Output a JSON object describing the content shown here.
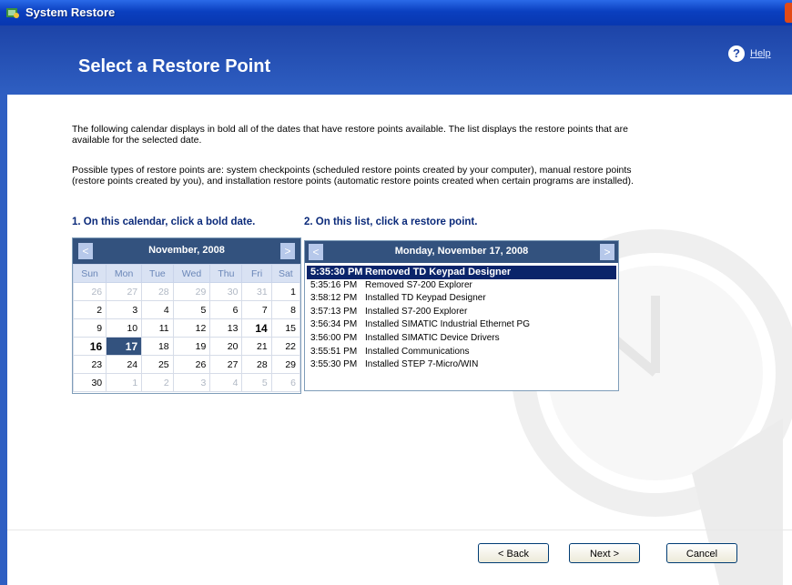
{
  "window": {
    "title": "System Restore"
  },
  "header": {
    "heading": "Select a Restore Point",
    "help_label": "Help"
  },
  "intro": {
    "p1": "The following calendar displays in bold all of the dates that have restore points available. The list displays the restore points that are available for the selected date.",
    "p2": "Possible types of restore points are: system checkpoints (scheduled restore points created by your computer), manual restore points (restore points created by you), and installation restore points (automatic restore points created when certain programs are installed)."
  },
  "steps": {
    "calendar_label": "1. On this calendar, click a bold date.",
    "list_label": "2. On this list, click a restore point."
  },
  "calendar": {
    "month": "November, 2008",
    "prev": "<",
    "next": ">",
    "weekdays": [
      "Sun",
      "Mon",
      "Tue",
      "Wed",
      "Thu",
      "Fri",
      "Sat"
    ],
    "weeks": [
      [
        {
          "d": "26",
          "dim": true
        },
        {
          "d": "27",
          "dim": true
        },
        {
          "d": "28",
          "dim": true
        },
        {
          "d": "29",
          "dim": true
        },
        {
          "d": "30",
          "dim": true
        },
        {
          "d": "31",
          "dim": true
        },
        {
          "d": "1"
        }
      ],
      [
        {
          "d": "2"
        },
        {
          "d": "3"
        },
        {
          "d": "4"
        },
        {
          "d": "5"
        },
        {
          "d": "6"
        },
        {
          "d": "7"
        },
        {
          "d": "8"
        }
      ],
      [
        {
          "d": "9"
        },
        {
          "d": "10"
        },
        {
          "d": "11"
        },
        {
          "d": "12"
        },
        {
          "d": "13"
        },
        {
          "d": "14",
          "bold": true
        },
        {
          "d": "15"
        }
      ],
      [
        {
          "d": "16",
          "bold": true
        },
        {
          "d": "17",
          "selected": true
        },
        {
          "d": "18"
        },
        {
          "d": "19"
        },
        {
          "d": "20"
        },
        {
          "d": "21"
        },
        {
          "d": "22"
        }
      ],
      [
        {
          "d": "23"
        },
        {
          "d": "24"
        },
        {
          "d": "25"
        },
        {
          "d": "26"
        },
        {
          "d": "27"
        },
        {
          "d": "28"
        },
        {
          "d": "29"
        }
      ],
      [
        {
          "d": "30"
        },
        {
          "d": "1",
          "dim": true
        },
        {
          "d": "2",
          "dim": true
        },
        {
          "d": "3",
          "dim": true
        },
        {
          "d": "4",
          "dim": true
        },
        {
          "d": "5",
          "dim": true
        },
        {
          "d": "6",
          "dim": true
        }
      ]
    ]
  },
  "restore_list": {
    "date": "Monday, November 17, 2008",
    "prev": "<",
    "next": ">",
    "items": [
      {
        "time": "5:35:30 PM",
        "desc": "Removed TD Keypad Designer",
        "selected": true
      },
      {
        "time": "5:35:16 PM",
        "desc": "Removed S7-200 Explorer"
      },
      {
        "time": "3:58:12 PM",
        "desc": "Installed TD Keypad Designer"
      },
      {
        "time": "3:57:13 PM",
        "desc": "Installed S7-200 Explorer"
      },
      {
        "time": "3:56:34 PM",
        "desc": "Installed SIMATIC Industrial Ethernet PG"
      },
      {
        "time": "3:56:00 PM",
        "desc": "Installed SIMATIC Device Drivers"
      },
      {
        "time": "3:55:51 PM",
        "desc": "Installed Communications"
      },
      {
        "time": "3:55:30 PM",
        "desc": "Installed STEP 7-Micro/WIN"
      }
    ]
  },
  "buttons": {
    "back": "< Back",
    "next": "Next >",
    "cancel": "Cancel"
  },
  "colors": {
    "header": "#2f5fc2",
    "titlebar": "#0a3fbf",
    "calendar_head": "#33527e",
    "selection": "#0a246a"
  }
}
